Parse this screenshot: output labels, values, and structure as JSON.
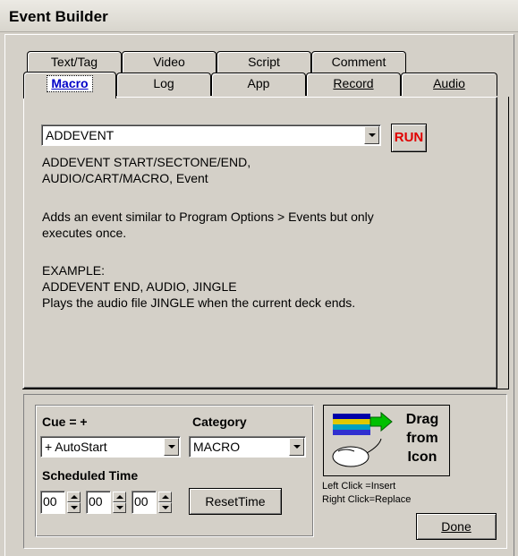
{
  "window": {
    "title": "Event Builder"
  },
  "tabs_back": [
    "Text/Tag",
    "Video",
    "Script",
    "Comment"
  ],
  "tabs_front": [
    {
      "label": "Macro",
      "underline": "M",
      "active": true
    },
    {
      "label": "Log"
    },
    {
      "label": "App"
    },
    {
      "label": "Record",
      "underline": "R"
    },
    {
      "label": "Audio",
      "underline": "A"
    }
  ],
  "macro": {
    "selected": "ADDEVENT",
    "run_label": "RUN",
    "description": {
      "syntax_line1": "ADDEVENT START/SECTONE/END,",
      "syntax_line2": "AUDIO/CART/MACRO, Event",
      "summary_line1": "Adds an event similar to Program Options > Events but only",
      "summary_line2": "executes once.",
      "example_header": "EXAMPLE:",
      "example_line": "ADDEVENT END, AUDIO, JINGLE",
      "example_desc": "Plays the audio file JINGLE when the current deck ends."
    }
  },
  "scheduler": {
    "cue_label": "Cue = +",
    "cue_value": "+ AutoStart",
    "category_label": "Category",
    "category_value": "MACRO",
    "scheduled_label": "Scheduled Time",
    "hours": "00",
    "minutes": "00",
    "seconds": "00",
    "reset_label": "ResetTime"
  },
  "drag": {
    "label_line1": "Drag",
    "label_line2": "from",
    "label_line3": "Icon",
    "hint_left": "Left Click  =Insert",
    "hint_right": "Right Click=Replace"
  },
  "done_label": "Done"
}
